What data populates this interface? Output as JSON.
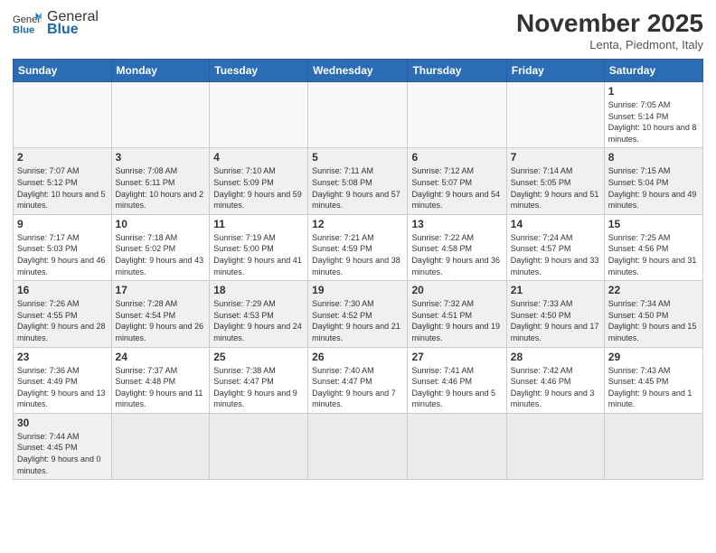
{
  "header": {
    "logo_general": "General",
    "logo_blue": "Blue",
    "month_title": "November 2025",
    "location": "Lenta, Piedmont, Italy"
  },
  "weekdays": [
    "Sunday",
    "Monday",
    "Tuesday",
    "Wednesday",
    "Thursday",
    "Friday",
    "Saturday"
  ],
  "weeks": [
    [
      {
        "day": "",
        "info": ""
      },
      {
        "day": "",
        "info": ""
      },
      {
        "day": "",
        "info": ""
      },
      {
        "day": "",
        "info": ""
      },
      {
        "day": "",
        "info": ""
      },
      {
        "day": "",
        "info": ""
      },
      {
        "day": "1",
        "info": "Sunrise: 7:05 AM\nSunset: 5:14 PM\nDaylight: 10 hours and 8 minutes."
      }
    ],
    [
      {
        "day": "2",
        "info": "Sunrise: 7:07 AM\nSunset: 5:12 PM\nDaylight: 10 hours and 5 minutes."
      },
      {
        "day": "3",
        "info": "Sunrise: 7:08 AM\nSunset: 5:11 PM\nDaylight: 10 hours and 2 minutes."
      },
      {
        "day": "4",
        "info": "Sunrise: 7:10 AM\nSunset: 5:09 PM\nDaylight: 9 hours and 59 minutes."
      },
      {
        "day": "5",
        "info": "Sunrise: 7:11 AM\nSunset: 5:08 PM\nDaylight: 9 hours and 57 minutes."
      },
      {
        "day": "6",
        "info": "Sunrise: 7:12 AM\nSunset: 5:07 PM\nDaylight: 9 hours and 54 minutes."
      },
      {
        "day": "7",
        "info": "Sunrise: 7:14 AM\nSunset: 5:05 PM\nDaylight: 9 hours and 51 minutes."
      },
      {
        "day": "8",
        "info": "Sunrise: 7:15 AM\nSunset: 5:04 PM\nDaylight: 9 hours and 49 minutes."
      }
    ],
    [
      {
        "day": "9",
        "info": "Sunrise: 7:17 AM\nSunset: 5:03 PM\nDaylight: 9 hours and 46 minutes."
      },
      {
        "day": "10",
        "info": "Sunrise: 7:18 AM\nSunset: 5:02 PM\nDaylight: 9 hours and 43 minutes."
      },
      {
        "day": "11",
        "info": "Sunrise: 7:19 AM\nSunset: 5:00 PM\nDaylight: 9 hours and 41 minutes."
      },
      {
        "day": "12",
        "info": "Sunrise: 7:21 AM\nSunset: 4:59 PM\nDaylight: 9 hours and 38 minutes."
      },
      {
        "day": "13",
        "info": "Sunrise: 7:22 AM\nSunset: 4:58 PM\nDaylight: 9 hours and 36 minutes."
      },
      {
        "day": "14",
        "info": "Sunrise: 7:24 AM\nSunset: 4:57 PM\nDaylight: 9 hours and 33 minutes."
      },
      {
        "day": "15",
        "info": "Sunrise: 7:25 AM\nSunset: 4:56 PM\nDaylight: 9 hours and 31 minutes."
      }
    ],
    [
      {
        "day": "16",
        "info": "Sunrise: 7:26 AM\nSunset: 4:55 PM\nDaylight: 9 hours and 28 minutes."
      },
      {
        "day": "17",
        "info": "Sunrise: 7:28 AM\nSunset: 4:54 PM\nDaylight: 9 hours and 26 minutes."
      },
      {
        "day": "18",
        "info": "Sunrise: 7:29 AM\nSunset: 4:53 PM\nDaylight: 9 hours and 24 minutes."
      },
      {
        "day": "19",
        "info": "Sunrise: 7:30 AM\nSunset: 4:52 PM\nDaylight: 9 hours and 21 minutes."
      },
      {
        "day": "20",
        "info": "Sunrise: 7:32 AM\nSunset: 4:51 PM\nDaylight: 9 hours and 19 minutes."
      },
      {
        "day": "21",
        "info": "Sunrise: 7:33 AM\nSunset: 4:50 PM\nDaylight: 9 hours and 17 minutes."
      },
      {
        "day": "22",
        "info": "Sunrise: 7:34 AM\nSunset: 4:50 PM\nDaylight: 9 hours and 15 minutes."
      }
    ],
    [
      {
        "day": "23",
        "info": "Sunrise: 7:36 AM\nSunset: 4:49 PM\nDaylight: 9 hours and 13 minutes."
      },
      {
        "day": "24",
        "info": "Sunrise: 7:37 AM\nSunset: 4:48 PM\nDaylight: 9 hours and 11 minutes."
      },
      {
        "day": "25",
        "info": "Sunrise: 7:38 AM\nSunset: 4:47 PM\nDaylight: 9 hours and 9 minutes."
      },
      {
        "day": "26",
        "info": "Sunrise: 7:40 AM\nSunset: 4:47 PM\nDaylight: 9 hours and 7 minutes."
      },
      {
        "day": "27",
        "info": "Sunrise: 7:41 AM\nSunset: 4:46 PM\nDaylight: 9 hours and 5 minutes."
      },
      {
        "day": "28",
        "info": "Sunrise: 7:42 AM\nSunset: 4:46 PM\nDaylight: 9 hours and 3 minutes."
      },
      {
        "day": "29",
        "info": "Sunrise: 7:43 AM\nSunset: 4:45 PM\nDaylight: 9 hours and 1 minute."
      }
    ],
    [
      {
        "day": "30",
        "info": "Sunrise: 7:44 AM\nSunset: 4:45 PM\nDaylight: 9 hours and 0 minutes."
      },
      {
        "day": "",
        "info": ""
      },
      {
        "day": "",
        "info": ""
      },
      {
        "day": "",
        "info": ""
      },
      {
        "day": "",
        "info": ""
      },
      {
        "day": "",
        "info": ""
      },
      {
        "day": "",
        "info": ""
      }
    ]
  ]
}
